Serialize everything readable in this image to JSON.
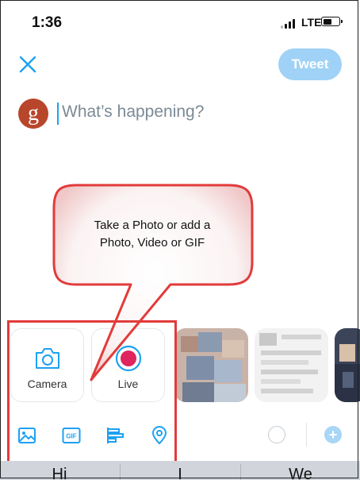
{
  "status_bar": {
    "time": "1:36",
    "network": "LTE",
    "battery_level": 0.6
  },
  "header": {
    "tweet_label": "Tweet"
  },
  "composer": {
    "placeholder": "What’s happening?",
    "avatar_letter": "g"
  },
  "callout": {
    "line1": "Take a Photo or add a",
    "line2": "Photo, Video or GIF"
  },
  "media": {
    "camera_label": "Camera",
    "live_label": "Live",
    "colors": {
      "accent": "#1da1f2",
      "live_dot": "#e0245e",
      "highlight": "#e23b3b"
    }
  },
  "toolbar": {
    "icons": [
      "image-icon",
      "gif-icon",
      "poll-icon",
      "location-icon"
    ],
    "gif_text": "GIF",
    "add_label": "+"
  },
  "keyboard": {
    "suggestions": [
      "Hi",
      "I",
      "We"
    ]
  }
}
